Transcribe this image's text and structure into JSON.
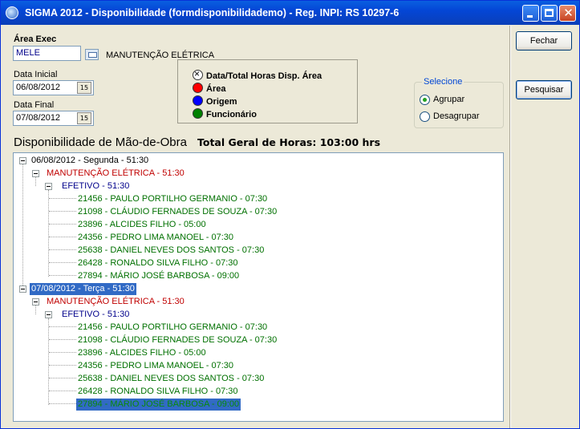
{
  "window": {
    "title": "SIGMA 2012 - Disponibilidade  (formdisponibilidademo)  - Reg. INPI: RS 10297-6",
    "close_glyph": "✕"
  },
  "filters": {
    "area_label": "Área Exec",
    "area_code": "MELE",
    "area_name": "MANUTENÇÃO ELÉTRICA",
    "start_label": "Data Inicial",
    "start_value": "06/08/2012",
    "end_label": "Data Final",
    "end_value": "07/08/2012",
    "calendar_glyph": "15"
  },
  "legend": {
    "items": [
      {
        "label": "Data/Total Horas Disp. Área",
        "color": "#ffffff",
        "icon": "cross-circle-icon"
      },
      {
        "label": "Área",
        "color": "#ff0000",
        "icon": "red-dot-icon"
      },
      {
        "label": "Origem",
        "color": "#0000ff",
        "icon": "blue-dot-icon"
      },
      {
        "label": "Funcionário",
        "color": "#008000",
        "icon": "green-dot-icon"
      }
    ]
  },
  "grouping": {
    "title": "Selecione",
    "options": [
      "Agrupar",
      "Desagrupar"
    ],
    "selected": "Agrupar"
  },
  "buttons": {
    "close": "Fechar",
    "search": "Pesquisar"
  },
  "summary": {
    "section_title": "Disponibilidade de Mão-de-Obra",
    "total": "Total Geral de Horas: 103:00 hrs"
  },
  "tree": {
    "days": [
      {
        "label": "06/08/2012 - Segunda - 51:30",
        "area": "MANUTENÇÃO ELÉTRICA - 51:30",
        "origin": "EFETIVO - 51:30",
        "employees": [
          "21456 - PAULO PORTILHO GERMANIO - 07:30",
          "21098 - CLÁUDIO FERNADES DE SOUZA - 07:30",
          "23896 - ALCIDES FILHO - 05:00",
          "24356 - PEDRO LIMA MANOEL - 07:30",
          "25638 - DANIEL NEVES DOS SANTOS - 07:30",
          "26428 - RONALDO SILVA FILHO - 07:30",
          "27894 - MÁRIO JOSÉ BARBOSA - 09:00"
        ]
      },
      {
        "label": "07/08/2012 - Terça - 51:30",
        "area": "MANUTENÇÃO ELÉTRICA - 51:30",
        "origin": "EFETIVO - 51:30",
        "employees": [
          "21456 - PAULO PORTILHO GERMANIO - 07:30",
          "21098 - CLÁUDIO FERNADES DE SOUZA - 07:30",
          "23896 - ALCIDES FILHO - 05:00",
          "24356 - PEDRO LIMA MANOEL - 07:30",
          "25638 - DANIEL NEVES DOS SANTOS - 07:30",
          "26428 - RONALDO SILVA FILHO - 07:30",
          "27894 - MÁRIO JOSÉ BARBOSA - 09:00"
        ]
      }
    ]
  }
}
